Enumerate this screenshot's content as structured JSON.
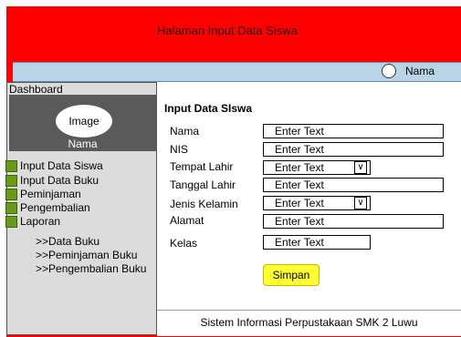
{
  "header": {
    "title": "Halaman Input Data Siswa"
  },
  "userbar": {
    "user_name": "Nama"
  },
  "sidebar": {
    "dashboard_label": "Dashboard",
    "profile": {
      "avatar_text": "Image",
      "name": "Nama"
    },
    "menu": [
      {
        "label": "Input Data Siswa"
      },
      {
        "label": "Input Data Buku"
      },
      {
        "label": "Peminjaman"
      },
      {
        "label": "Pengembalian"
      },
      {
        "label": "Laporan"
      }
    ],
    "submenu": [
      {
        "label": ">>Data Buku"
      },
      {
        "label": ">>Peminjaman Buku"
      },
      {
        "label": ">>Pengembalian Buku"
      }
    ]
  },
  "form": {
    "title": "Input Data SIswa",
    "fields": [
      {
        "label": "Nama",
        "value": "Enter Text"
      },
      {
        "label": "NIS",
        "value": "Enter Text"
      },
      {
        "label": "Tempat Lahir",
        "value": "Enter Text"
      },
      {
        "label": "Tanggal Lahir",
        "value": "Enter Text"
      },
      {
        "label": "Jenis Kelamin",
        "value": "Enter Text"
      },
      {
        "label": "Alamat",
        "value": "Enter Text"
      },
      {
        "label": "Kelas",
        "value": "Enter Text"
      }
    ],
    "dropdown_glyph": "∨",
    "submit_label": "Simpan"
  },
  "footer": {
    "text": "Sistem Informasi Perpustakaan SMK 2 Luwu"
  },
  "colors": {
    "frame": "#ff0000",
    "userbar": "#b8d4e6",
    "menu_icon": "#6a9a1a",
    "button": "#ffff33"
  }
}
